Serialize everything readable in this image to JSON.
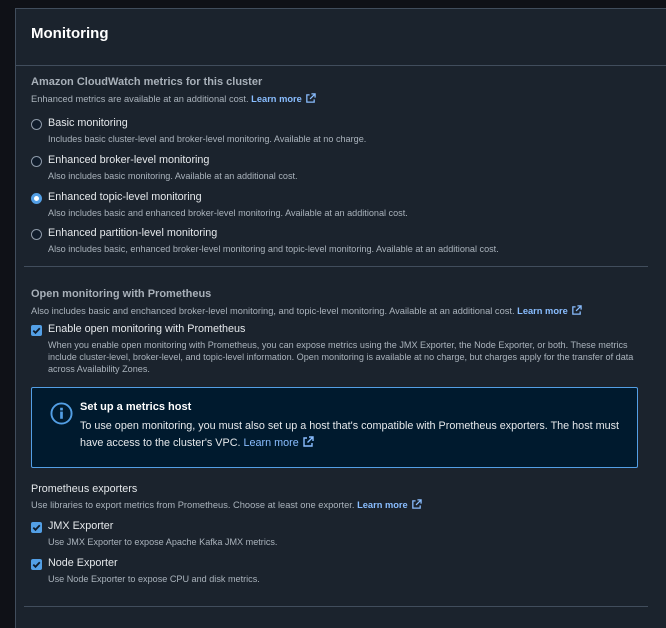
{
  "header": {
    "title": "Monitoring"
  },
  "cloudwatch": {
    "title": "Amazon CloudWatch metrics for this cluster",
    "description": "Enhanced metrics are available at an additional cost.",
    "learn_more": "Learn more",
    "options": [
      {
        "label": "Basic monitoring",
        "description": "Includes basic cluster-level and broker-level monitoring. Available at no charge.",
        "selected": false
      },
      {
        "label": "Enhanced broker-level monitoring",
        "description": "Also includes basic monitoring. Available at an additional cost.",
        "selected": false
      },
      {
        "label": "Enhanced topic-level monitoring",
        "description": "Also includes basic and enhanced broker-level monitoring. Available at an additional cost.",
        "selected": true
      },
      {
        "label": "Enhanced partition-level monitoring",
        "description": "Also includes basic, enhanced broker-level monitoring and topic-level monitoring. Available at an additional cost.",
        "selected": false
      }
    ]
  },
  "prometheus": {
    "title": "Open monitoring with Prometheus",
    "description": "Also includes basic and enchanced broker-level monitoring, and topic-level monitoring. Available at an additional cost.",
    "learn_more": "Learn more",
    "enable_label": "Enable open monitoring with Prometheus",
    "enable_checked": true,
    "enable_description": "When you enable open monitoring with Prometheus, you can expose metrics using the JMX Exporter, the Node Exporter, or both. These metrics include cluster-level, broker-level, and topic-level information. Open monitoring is available at no charge, but charges apply for the transfer of data across Availability Zones."
  },
  "info": {
    "title": "Set up a metrics host",
    "body": "To use open monitoring, you must also set up a host that's compatible with Prometheus exporters. The host must have access to the cluster's VPC.",
    "learn_more": "Learn more"
  },
  "exporters": {
    "title": "Prometheus exporters",
    "description": "Use libraries to export metrics from Prometheus. Choose at least one exporter.",
    "learn_more": "Learn more",
    "items": [
      {
        "label": "JMX Exporter",
        "description": "Use JMX Exporter to expose Apache Kafka JMX metrics.",
        "checked": true
      },
      {
        "label": "Node Exporter",
        "description": "Use Node Exporter to expose CPU and disk metrics.",
        "checked": true
      }
    ]
  },
  "colors": {
    "accent": "#539fe5",
    "link": "#89bdff",
    "panel": "#1b232d",
    "border": "#414d5c"
  },
  "icons": [
    "external-link-icon",
    "info-icon",
    "checkmark-icon"
  ]
}
